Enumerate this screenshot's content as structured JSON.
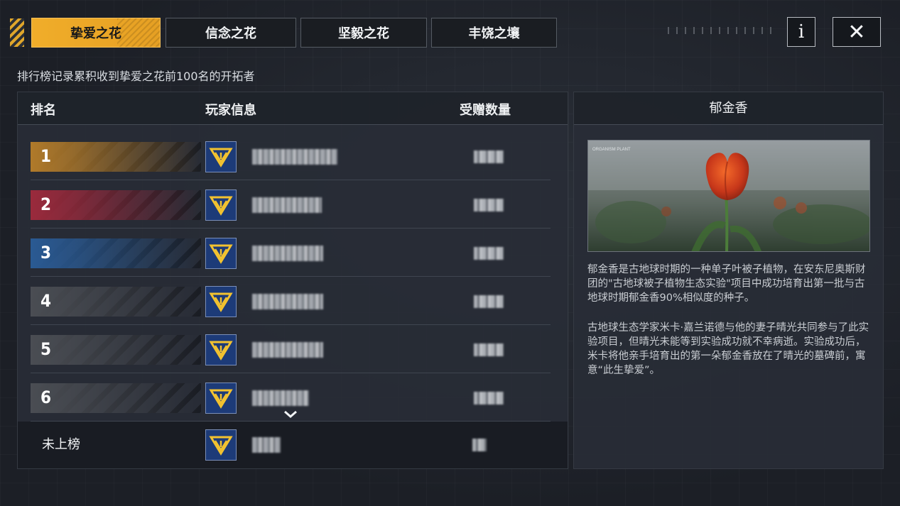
{
  "tabs": [
    {
      "label": "挚爱之花",
      "active": true
    },
    {
      "label": "信念之花",
      "active": false
    },
    {
      "label": "坚毅之花",
      "active": false
    },
    {
      "label": "丰饶之壤",
      "active": false
    }
  ],
  "info_button": "i",
  "close_button": "✕",
  "subtitle": "排行榜记录累积收到挚爱之花前100名的开拓者",
  "leaderboard": {
    "headers": {
      "rank": "排名",
      "player": "玩家信息",
      "count": "受赠数量"
    },
    "rows": [
      {
        "rank": "1",
        "color": "#b07a2a"
      },
      {
        "rank": "2",
        "color": "#9a2a3c"
      },
      {
        "rank": "3",
        "color": "#2a5a93"
      },
      {
        "rank": "4",
        "color": "#4a4d53"
      },
      {
        "rank": "5",
        "color": "#4a4d53"
      },
      {
        "rank": "6",
        "color": "#4a4d53"
      }
    ],
    "unranked_label": "未上榜"
  },
  "detail": {
    "title": "郁金香",
    "paragraph1": "郁金香是古地球时期的一种单子叶被子植物，在安东尼奥斯财团的\"古地球被子植物生态实验\"项目中成功培育出第一批与古地球时期郁金香90%相似度的种子。",
    "paragraph2": "古地球生态学家米卡·嘉兰诺德与他的妻子晴光共同参与了此实验项目，但晴光未能等到实验成功就不幸病逝。实验成功后，米卡将他亲手培育出的第一朵郁金香放在了晴光的墓碑前，寓意“此生挚爱”。",
    "image_caption": "ORGANISM PLANT"
  },
  "colors": {
    "accent": "#f0ad2a",
    "panel": "#282d36"
  }
}
